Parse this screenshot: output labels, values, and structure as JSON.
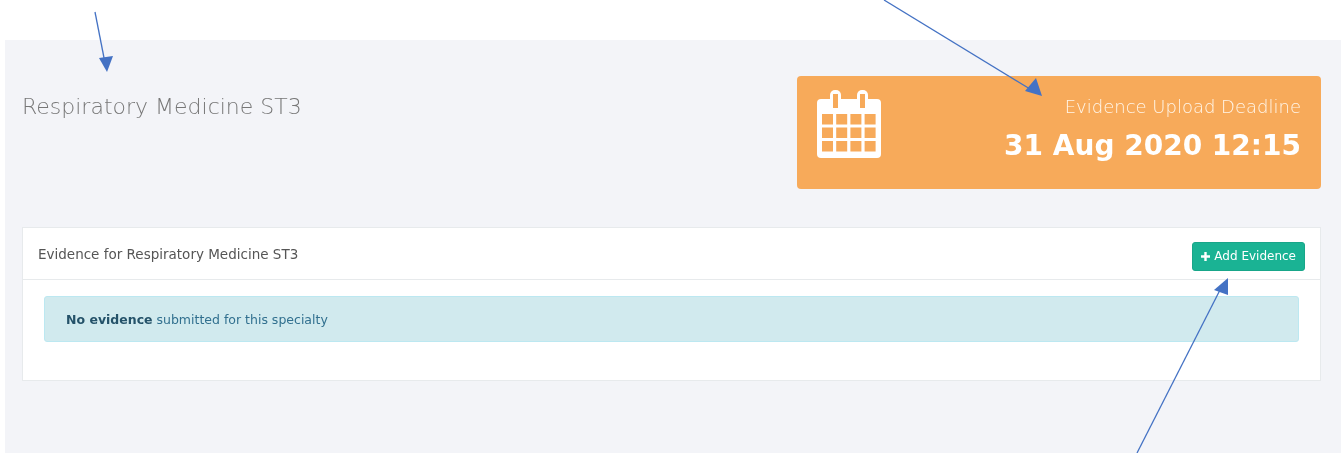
{
  "page_title": "Respiratory Medicine ST3",
  "deadline": {
    "label": "Evidence Upload Deadline",
    "date": "31 Aug 2020 12:15"
  },
  "evidence_panel": {
    "title": "Evidence for Respiratory Medicine ST3",
    "add_button": "Add Evidence",
    "alert": "**No evidence** submitted for this specialty"
  }
}
